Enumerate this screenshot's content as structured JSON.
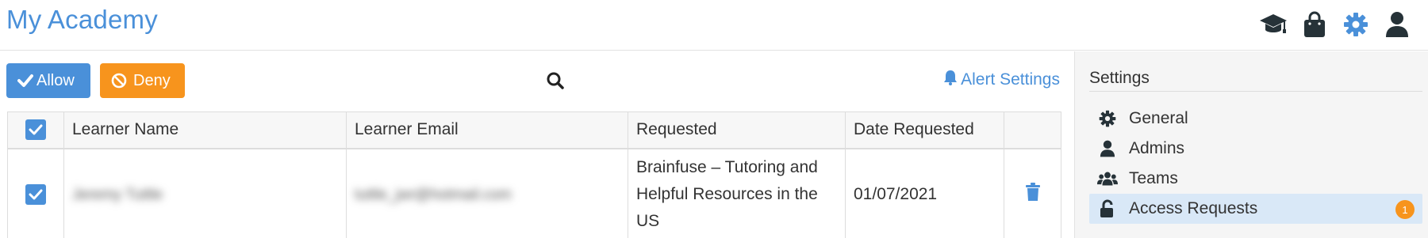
{
  "app": {
    "title": "My Academy",
    "brand_color": "#4a90d9",
    "accent_orange": "#f7941d"
  },
  "header": {
    "icons": [
      "graduation-cap-icon",
      "shopping-bag-icon",
      "gear-icon",
      "user-icon"
    ]
  },
  "toolbar": {
    "allow_label": "Allow",
    "deny_label": "Deny",
    "alert_settings_label": "Alert Settings"
  },
  "table": {
    "columns": [
      "Learner Name",
      "Learner Email",
      "Requested",
      "Date Requested"
    ],
    "rows": [
      {
        "checked": true,
        "learner_name": "Jeremy Tuttle",
        "learner_email": "tuttle_jwr@hotmail.com",
        "requested": "Brainfuse – Tutoring and Helpful Resources in the US",
        "date_requested": "01/07/2021"
      }
    ]
  },
  "sidebar": {
    "title": "Settings",
    "items": [
      {
        "label": "General",
        "icon": "gear-icon",
        "active": false
      },
      {
        "label": "Admins",
        "icon": "user-icon",
        "active": false
      },
      {
        "label": "Teams",
        "icon": "users-icon",
        "active": false
      },
      {
        "label": "Access Requests",
        "icon": "unlock-icon",
        "active": true,
        "badge": "1"
      }
    ]
  }
}
